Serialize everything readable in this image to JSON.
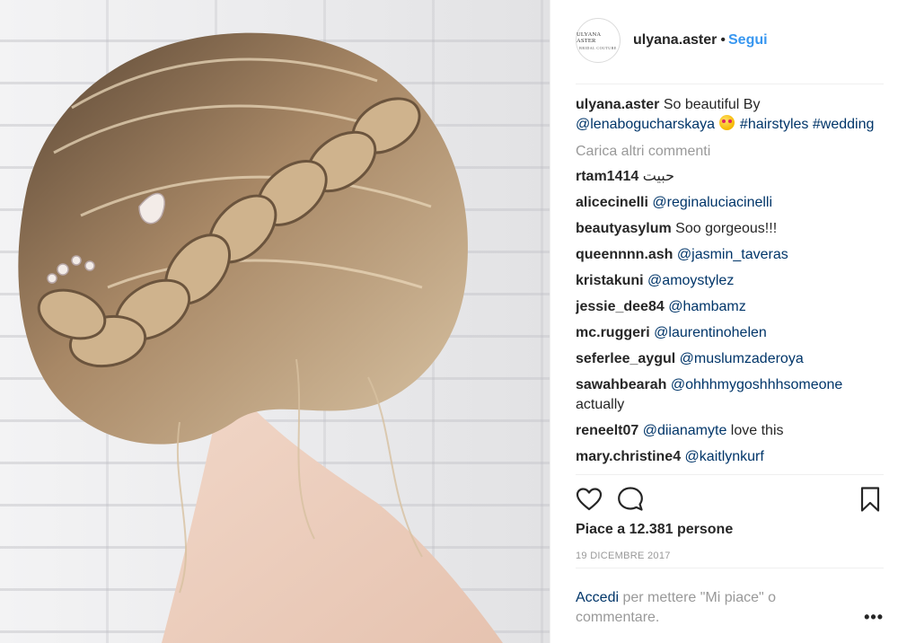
{
  "post": {
    "photo_alt": "Braided bridal updo hairstyle",
    "author": {
      "avatar_line1": "ULYANA ASTER",
      "avatar_line2": "BRIDAL COUTURE",
      "username": "ulyana.aster",
      "separator": "•",
      "follow_label": "Segui"
    },
    "caption": {
      "username": "ulyana.aster",
      "text": "So beautiful By",
      "mention": "@lenabogucharskaya",
      "emoji": "😍",
      "hashtag1": "#hairstyles",
      "hashtag2": "#wedding"
    },
    "load_more": "Carica altri commenti",
    "comments": [
      {
        "user": "rtam1414",
        "text": "حبيت",
        "mention": ""
      },
      {
        "user": "alicecinelli",
        "text": "",
        "mention": "@reginaluciacinelli"
      },
      {
        "user": "beautyasylum",
        "text": "Soo gorgeous!!!",
        "mention": ""
      },
      {
        "user": "queennnn.ash",
        "text": "",
        "mention": "@jasmin_taveras"
      },
      {
        "user": "kristakuni",
        "text": "",
        "mention": "@amoystylez"
      },
      {
        "user": "jessie_dee84",
        "text": "",
        "mention": "@hambamz"
      },
      {
        "user": "mc.ruggeri",
        "text": "",
        "mention": "@laurentinohelen"
      },
      {
        "user": "seferlee_aygul",
        "text": "",
        "mention": "@muslumzaderoya"
      },
      {
        "user": "sawahbearah",
        "text": "actually",
        "mention": "@ohhhmygoshhhsomeone"
      },
      {
        "user": "reneelt07",
        "text": "love this",
        "mention": "@diianamyte"
      },
      {
        "user": "mary.christine4",
        "text": "",
        "mention": "@kaitlynkurf"
      }
    ],
    "likes_text": "Piace a 12.381 persone",
    "date": "19 DICEMBRE 2017",
    "login_link": "Accedi",
    "login_text": "per mettere \"Mi piace\" o commentare.",
    "more_options": "•••",
    "icons": [
      "heart-icon",
      "comment-icon",
      "bookmark-icon"
    ]
  }
}
